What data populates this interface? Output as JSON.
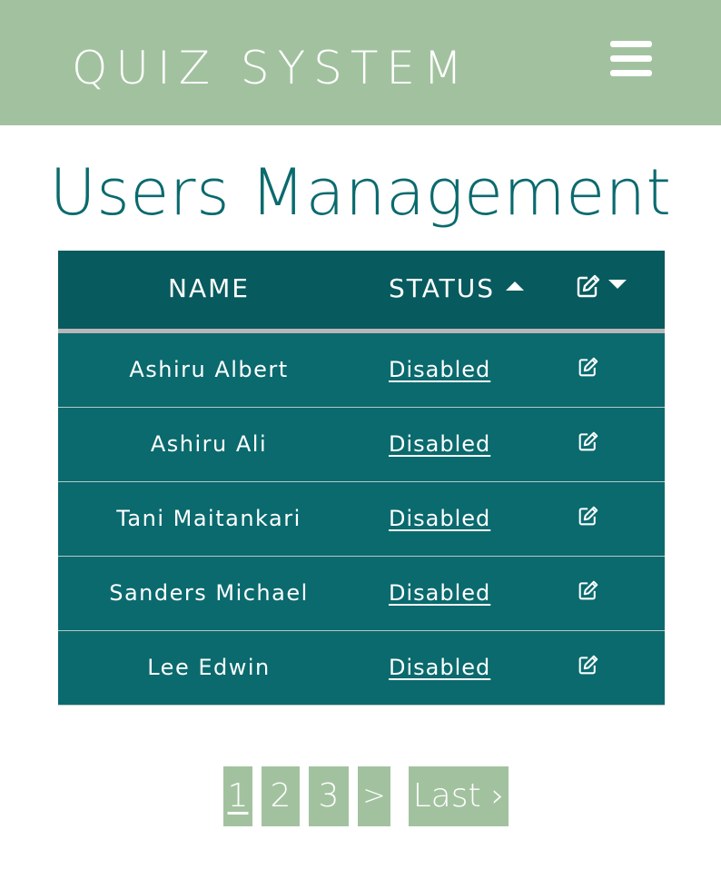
{
  "header": {
    "brand": "QUIZ SYSTEM",
    "menu_icon": "hamburger-menu-icon",
    "background": "#a2c29f"
  },
  "page": {
    "title": "Users Management",
    "title_color": "#0a6a6e"
  },
  "table": {
    "columns": {
      "name": "NAME",
      "status": "STATUS",
      "actions_icon": "edit-icon"
    },
    "sort": {
      "column": "STATUS",
      "direction": "ascending"
    },
    "header_color": "#075a5e",
    "row_color": "#0a6a6e",
    "rows": [
      {
        "name": "Ashiru Albert",
        "status": "Disabled"
      },
      {
        "name": "Ashiru Ali",
        "status": "Disabled"
      },
      {
        "name": "Tani Maitankari",
        "status": "Disabled"
      },
      {
        "name": "Sanders Michael",
        "status": "Disabled"
      },
      {
        "name": "Lee Edwin",
        "status": "Disabled"
      }
    ]
  },
  "pagination": {
    "pages": [
      "1",
      "2",
      "3"
    ],
    "current": "1",
    "next_label": ">",
    "last_label": "Last ›"
  }
}
